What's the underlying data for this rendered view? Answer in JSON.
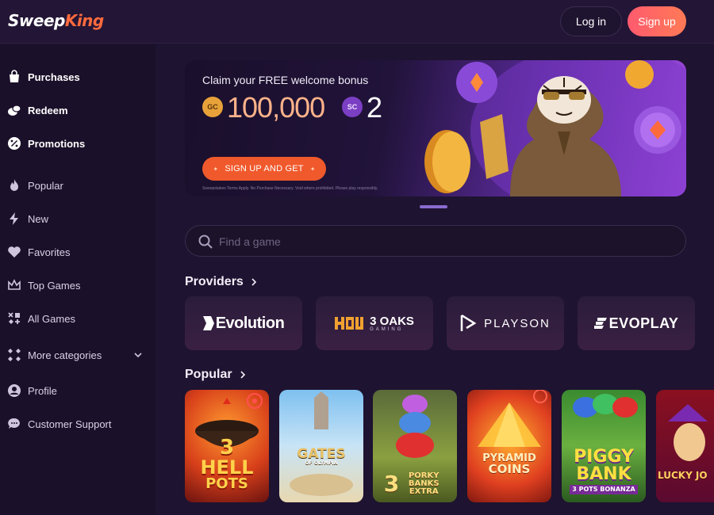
{
  "header": {
    "logo_part1": "Sweep",
    "logo_part2": "King",
    "login_label": "Log in",
    "signup_label": "Sign up"
  },
  "sidebar": {
    "items": [
      {
        "label": "Purchases",
        "icon": "shopping-bag-icon"
      },
      {
        "label": "Redeem",
        "icon": "coins-icon"
      },
      {
        "label": "Promotions",
        "icon": "percent-icon"
      },
      {
        "label": "Popular",
        "icon": "flame-icon"
      },
      {
        "label": "New",
        "icon": "lightning-icon"
      },
      {
        "label": "Favorites",
        "icon": "heart-icon"
      },
      {
        "label": "Top Games",
        "icon": "crown-icon"
      },
      {
        "label": "All Games",
        "icon": "grid-icon"
      },
      {
        "label": "More categories",
        "icon": "categories-icon"
      },
      {
        "label": "Profile",
        "icon": "user-icon"
      },
      {
        "label": "Customer Support",
        "icon": "chat-icon"
      }
    ]
  },
  "banner": {
    "title": "Claim your FREE welcome bonus",
    "gc_label": "GC",
    "gc_amount": "100,000",
    "sc_label": "SC",
    "sc_amount": "2",
    "cta_label": "SIGN UP AND GET",
    "fine_print": "Sweepstakes Terms Apply. No Purchase Necessary. Void where prohibited. Please play responsibly."
  },
  "search": {
    "placeholder": "Find a game"
  },
  "providers": {
    "title": "Providers",
    "items": [
      "Evolution",
      "3 OAKS",
      "PLAYSON",
      "EVOPLAY"
    ],
    "oaks_sub": "GAMING"
  },
  "popular": {
    "title": "Popular",
    "games": [
      {
        "line1": "3",
        "line2": "HELL",
        "line3": "POTS"
      },
      {
        "line1": "GATES",
        "line2": "OF OLYMPIA",
        "line3": ""
      },
      {
        "line1": "3",
        "line2": "PORKY BANKS",
        "line3": "EXTRA"
      },
      {
        "line1": "PYRAMID",
        "line2": "COINS",
        "line3": ""
      },
      {
        "line1": "PIGGY",
        "line2": "BANK",
        "line3": "3 POTS BONANZA"
      },
      {
        "line1": "LUCKY JO",
        "line2": "",
        "line3": ""
      }
    ]
  },
  "colors": {
    "accent": "#ff6a3d",
    "signup_gradient_start": "#ff5a6e",
    "cta": "#f0592c",
    "background": "#1e1330"
  }
}
